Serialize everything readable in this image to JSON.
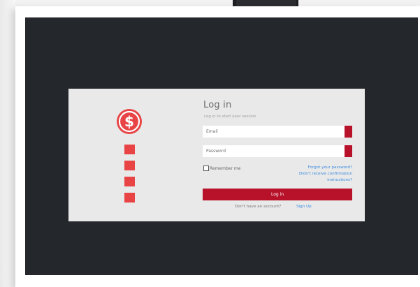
{
  "login": {
    "title": "Log in",
    "subtitle": "Log in to start your session",
    "email_placeholder": "Email",
    "password_placeholder": "Password",
    "remember_label": "Remember me",
    "forgot_password": "Forgot your password?",
    "confirmation_line1": "Didn't receive confirmation",
    "confirmation_line2": "instructions?",
    "login_button": "Log in",
    "no_account_text": "Don't have an account?",
    "signup_link": "Sign Up"
  },
  "colors": {
    "brand_red": "#b8122b",
    "logo_red": "#e84446",
    "link_blue": "#3d8ae0",
    "dark_bg": "#24272b",
    "card_bg": "#e8e9e8"
  },
  "icons": {
    "logo": "dollar-circle-icon",
    "decor_blocks": "square-icon"
  }
}
